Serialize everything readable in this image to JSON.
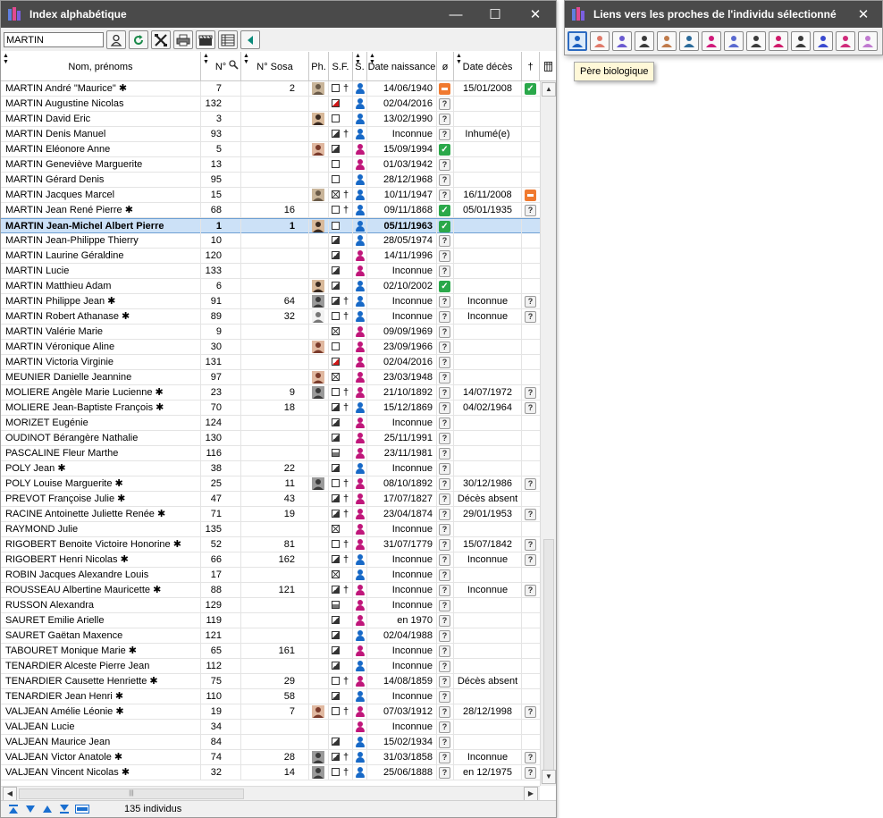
{
  "main_window": {
    "title": "Index alphabétique",
    "search_value": "MARTIN",
    "toolbar_icons": [
      "person-search-icon",
      "refresh-icon",
      "tools-icon",
      "print-icon",
      "clapperboard-icon",
      "table-icon",
      "collapse-left-icon"
    ],
    "columns": {
      "name": "Nom, prénoms",
      "num": "N°",
      "sosa": "N° Sosa",
      "photo": "Ph.",
      "sf": "S.F.",
      "sex": "S.",
      "birth": "Date naissance",
      "o": "ø",
      "death": "Date décès",
      "dagger": "†"
    },
    "status_text": "135  individus"
  },
  "links_window": {
    "title": "Liens vers les proches de l'individu sélectionné",
    "tooltip": "Père biologique",
    "icons": [
      "father-icon",
      "mother-icon",
      "parents-icon",
      "siblings-icon",
      "couple-icon",
      "children-icon",
      "ring-icon",
      "family-icon",
      "grandparents-icon",
      "half-siblings-icon",
      "cousins-icon",
      "descendants-icon",
      "ancestors-icon",
      "tree-chart-icon"
    ]
  },
  "colors": {
    "male": "#1769c7",
    "female": "#c0167a",
    "selected_row": "#cce1f7",
    "ok_badge": "#2aa84a",
    "warn_badge": "#f07a30",
    "titlebar": "#4a4a4a"
  },
  "rows": [
    {
      "name": "MARTIN André \"Maurice\"",
      "star": true,
      "num": "7",
      "sosa": "2",
      "photo": "man-old",
      "sf": "empty",
      "dagger": true,
      "sex": "m",
      "birth": "14/06/1940",
      "o": "minus",
      "death": "15/01/2008",
      "d": "ok"
    },
    {
      "name": "MARTIN Augustine Nicolas",
      "star": false,
      "num": "132",
      "sosa": "",
      "photo": "",
      "sf": "red",
      "dagger": false,
      "sex": "m",
      "birth": "02/04/2016",
      "o": "q",
      "death": "",
      "d": ""
    },
    {
      "name": "MARTIN David Eric",
      "star": false,
      "num": "3",
      "sosa": "",
      "photo": "man-young",
      "sf": "empty",
      "dagger": false,
      "sex": "m",
      "birth": "13/02/1990",
      "o": "q",
      "death": "",
      "d": ""
    },
    {
      "name": "MARTIN Denis Manuel",
      "star": false,
      "num": "93",
      "sosa": "",
      "photo": "",
      "sf": "half",
      "dagger": true,
      "sex": "m",
      "birth": "Inconnue",
      "o": "q",
      "death": "Inhumé(e)",
      "d": ""
    },
    {
      "name": "MARTIN Eléonore Anne",
      "star": false,
      "num": "5",
      "sosa": "",
      "photo": "woman",
      "sf": "half",
      "dagger": false,
      "sex": "f",
      "birth": "15/09/1994",
      "o": "ok",
      "death": "",
      "d": ""
    },
    {
      "name": "MARTIN Geneviève Marguerite",
      "star": false,
      "num": "13",
      "sosa": "",
      "photo": "",
      "sf": "empty",
      "dagger": false,
      "sex": "f",
      "birth": "01/03/1942",
      "o": "q",
      "death": "",
      "d": ""
    },
    {
      "name": "MARTIN Gérard Denis",
      "star": false,
      "num": "95",
      "sosa": "",
      "photo": "",
      "sf": "empty",
      "dagger": false,
      "sex": "m",
      "birth": "28/12/1968",
      "o": "q",
      "death": "",
      "d": ""
    },
    {
      "name": "MARTIN Jacques Marcel",
      "star": false,
      "num": "15",
      "sosa": "",
      "photo": "man-old",
      "sf": "x",
      "dagger": true,
      "sex": "m",
      "birth": "10/11/1947",
      "o": "q",
      "death": "16/11/2008",
      "d": "minus"
    },
    {
      "name": "MARTIN Jean René Pierre",
      "star": true,
      "num": "68",
      "sosa": "16",
      "photo": "",
      "sf": "empty",
      "dagger": true,
      "sex": "m",
      "birth": "09/11/1868",
      "o": "ok",
      "death": "05/01/1935",
      "d": "q"
    },
    {
      "name": "MARTIN Jean-Michel Albert Pierre",
      "star": false,
      "num": "1",
      "sosa": "1",
      "photo": "man-young",
      "sf": "empty",
      "dagger": false,
      "sex": "m",
      "birth": "05/11/1963",
      "o": "ok",
      "death": "",
      "d": "",
      "selected": true
    },
    {
      "name": "MARTIN Jean-Philippe Thierry",
      "star": false,
      "num": "10",
      "sosa": "",
      "photo": "",
      "sf": "half",
      "dagger": false,
      "sex": "m",
      "birth": "28/05/1974",
      "o": "q",
      "death": "",
      "d": ""
    },
    {
      "name": "MARTIN Laurine Géraldine",
      "star": false,
      "num": "120",
      "sosa": "",
      "photo": "",
      "sf": "half",
      "dagger": false,
      "sex": "f",
      "birth": "14/11/1996",
      "o": "q",
      "death": "",
      "d": ""
    },
    {
      "name": "MARTIN Lucie",
      "star": false,
      "num": "133",
      "sosa": "",
      "photo": "",
      "sf": "half",
      "dagger": false,
      "sex": "f",
      "birth": "Inconnue",
      "o": "q",
      "death": "",
      "d": ""
    },
    {
      "name": "MARTIN Matthieu Adam",
      "star": false,
      "num": "6",
      "sosa": "",
      "photo": "man-young",
      "sf": "half",
      "dagger": false,
      "sex": "m",
      "birth": "02/10/2002",
      "o": "ok",
      "death": "",
      "d": ""
    },
    {
      "name": "MARTIN Philippe Jean",
      "star": true,
      "num": "91",
      "sosa": "64",
      "photo": "old-photo",
      "sf": "half",
      "dagger": true,
      "sex": "m",
      "birth": "Inconnue",
      "o": "q",
      "death": "Inconnue",
      "d": "q"
    },
    {
      "name": "MARTIN Robert Athanase",
      "star": true,
      "num": "89",
      "sosa": "32",
      "photo": "sketch",
      "sf": "empty",
      "dagger": true,
      "sex": "m",
      "birth": "Inconnue",
      "o": "q",
      "death": "Inconnue",
      "d": "q"
    },
    {
      "name": "MARTIN Valérie Marie",
      "star": false,
      "num": "9",
      "sosa": "",
      "photo": "",
      "sf": "x",
      "dagger": false,
      "sex": "f",
      "birth": "09/09/1969",
      "o": "q",
      "death": "",
      "d": ""
    },
    {
      "name": "MARTIN Véronique Aline",
      "star": false,
      "num": "30",
      "sosa": "",
      "photo": "woman",
      "sf": "empty",
      "dagger": false,
      "sex": "f",
      "birth": "23/09/1966",
      "o": "q",
      "death": "",
      "d": ""
    },
    {
      "name": "MARTIN Victoria Virginie",
      "star": false,
      "num": "131",
      "sosa": "",
      "photo": "",
      "sf": "red",
      "dagger": false,
      "sex": "f",
      "birth": "02/04/2016",
      "o": "q",
      "death": "",
      "d": ""
    },
    {
      "name": "MEUNIER Danielle Jeannine",
      "star": false,
      "num": "97",
      "sosa": "",
      "photo": "woman",
      "sf": "x",
      "dagger": false,
      "sex": "f",
      "birth": "23/03/1948",
      "o": "q",
      "death": "",
      "d": ""
    },
    {
      "name": "MOLIERE Angèle Marie Lucienne",
      "star": true,
      "num": "23",
      "sosa": "9",
      "photo": "old-photo",
      "sf": "empty",
      "dagger": true,
      "sex": "f",
      "birth": "21/10/1892",
      "o": "q",
      "death": "14/07/1972",
      "d": "q"
    },
    {
      "name": "MOLIERE Jean-Baptiste François",
      "star": true,
      "num": "70",
      "sosa": "18",
      "photo": "",
      "sf": "half",
      "dagger": true,
      "sex": "m",
      "birth": "15/12/1869",
      "o": "q",
      "death": "04/02/1964",
      "d": "q"
    },
    {
      "name": "MORIZET Eugénie",
      "star": false,
      "num": "124",
      "sosa": "",
      "photo": "",
      "sf": "half",
      "dagger": false,
      "sex": "f",
      "birth": "Inconnue",
      "o": "q",
      "death": "",
      "d": ""
    },
    {
      "name": "OUDINOT Bérangère Nathalie",
      "star": false,
      "num": "130",
      "sosa": "",
      "photo": "",
      "sf": "half",
      "dagger": false,
      "sex": "f",
      "birth": "25/11/1991",
      "o": "q",
      "death": "",
      "d": ""
    },
    {
      "name": "PASCALINE Fleur Marthe",
      "star": false,
      "num": "116",
      "sosa": "",
      "photo": "",
      "sf": "ax",
      "dagger": false,
      "sex": "f",
      "birth": "23/11/1981",
      "o": "q",
      "death": "",
      "d": ""
    },
    {
      "name": "POLY Jean",
      "star": true,
      "num": "38",
      "sosa": "22",
      "photo": "",
      "sf": "half",
      "dagger": false,
      "sex": "m",
      "birth": "Inconnue",
      "o": "q",
      "death": "",
      "d": ""
    },
    {
      "name": "POLY Louise Marguerite",
      "star": true,
      "num": "25",
      "sosa": "11",
      "photo": "old-photo",
      "sf": "empty",
      "dagger": true,
      "sex": "f",
      "birth": "08/10/1892",
      "o": "q",
      "death": "30/12/1986",
      "d": "q"
    },
    {
      "name": "PREVOT Françoise Julie",
      "star": true,
      "num": "47",
      "sosa": "43",
      "photo": "",
      "sf": "half",
      "dagger": true,
      "sex": "f",
      "birth": "17/07/1827",
      "o": "q",
      "death": "Décès absent",
      "d": ""
    },
    {
      "name": "RACINE Antoinette Juliette Renée",
      "star": true,
      "num": "71",
      "sosa": "19",
      "photo": "",
      "sf": "half",
      "dagger": true,
      "sex": "f",
      "birth": "23/04/1874",
      "o": "q",
      "death": "29/01/1953",
      "d": "q"
    },
    {
      "name": "RAYMOND Julie",
      "star": false,
      "num": "135",
      "sosa": "",
      "photo": "",
      "sf": "x",
      "dagger": false,
      "sex": "f",
      "birth": "Inconnue",
      "o": "q",
      "death": "",
      "d": ""
    },
    {
      "name": "RIGOBERT Benoite Victoire Honorine",
      "star": true,
      "num": "52",
      "sosa": "81",
      "photo": "",
      "sf": "empty",
      "dagger": true,
      "sex": "f",
      "birth": "31/07/1779",
      "o": "q",
      "death": "15/07/1842",
      "d": "q"
    },
    {
      "name": "RIGOBERT Henri Nicolas",
      "star": true,
      "num": "66",
      "sosa": "162",
      "photo": "",
      "sf": "half",
      "dagger": true,
      "sex": "m",
      "birth": "Inconnue",
      "o": "q",
      "death": "Inconnue",
      "d": "q"
    },
    {
      "name": "ROBIN Jacques Alexandre Louis",
      "star": false,
      "num": "17",
      "sosa": "",
      "photo": "",
      "sf": "x",
      "dagger": false,
      "sex": "m",
      "birth": "Inconnue",
      "o": "q",
      "death": "",
      "d": ""
    },
    {
      "name": "ROUSSEAU Albertine Mauricette",
      "star": true,
      "num": "88",
      "sosa": "121",
      "photo": "",
      "sf": "half",
      "dagger": true,
      "sex": "f",
      "birth": "Inconnue",
      "o": "q",
      "death": "Inconnue",
      "d": "q"
    },
    {
      "name": "RUSSON Alexandra",
      "star": false,
      "num": "129",
      "sosa": "",
      "photo": "",
      "sf": "ax",
      "dagger": false,
      "sex": "f",
      "birth": "Inconnue",
      "o": "q",
      "death": "",
      "d": ""
    },
    {
      "name": "SAURET Emilie Arielle",
      "star": false,
      "num": "119",
      "sosa": "",
      "photo": "",
      "sf": "half",
      "dagger": false,
      "sex": "f",
      "birth": "en 1970",
      "o": "q",
      "death": "",
      "d": ""
    },
    {
      "name": "SAURET Gaëtan Maxence",
      "star": false,
      "num": "121",
      "sosa": "",
      "photo": "",
      "sf": "half",
      "dagger": false,
      "sex": "m",
      "birth": "02/04/1988",
      "o": "q",
      "death": "",
      "d": ""
    },
    {
      "name": "TABOURET Monique Marie",
      "star": true,
      "num": "65",
      "sosa": "161",
      "photo": "",
      "sf": "half",
      "dagger": false,
      "sex": "f",
      "birth": "Inconnue",
      "o": "q",
      "death": "",
      "d": ""
    },
    {
      "name": "TENARDIER Alceste Pierre Jean",
      "star": false,
      "num": "112",
      "sosa": "",
      "photo": "",
      "sf": "half",
      "dagger": false,
      "sex": "m",
      "birth": "Inconnue",
      "o": "q",
      "death": "",
      "d": ""
    },
    {
      "name": "TENARDIER Causette Henriette",
      "star": true,
      "num": "75",
      "sosa": "29",
      "photo": "",
      "sf": "empty",
      "dagger": true,
      "sex": "f",
      "birth": "14/08/1859",
      "o": "q",
      "death": "Décès absent",
      "d": ""
    },
    {
      "name": "TENARDIER Jean Henri",
      "star": true,
      "num": "110",
      "sosa": "58",
      "photo": "",
      "sf": "half",
      "dagger": false,
      "sex": "m",
      "birth": "Inconnue",
      "o": "q",
      "death": "",
      "d": ""
    },
    {
      "name": "VALJEAN Amélie Léonie",
      "star": true,
      "num": "19",
      "sosa": "7",
      "photo": "woman",
      "sf": "empty",
      "dagger": true,
      "sex": "f",
      "birth": "07/03/1912",
      "o": "q",
      "death": "28/12/1998",
      "d": "q"
    },
    {
      "name": "VALJEAN Lucie",
      "star": false,
      "num": "34",
      "sosa": "",
      "photo": "",
      "sf": "",
      "dagger": false,
      "sex": "f",
      "birth": "Inconnue",
      "o": "q",
      "death": "",
      "d": ""
    },
    {
      "name": "VALJEAN Maurice Jean",
      "star": false,
      "num": "84",
      "sosa": "",
      "photo": "",
      "sf": "half",
      "dagger": false,
      "sex": "m",
      "birth": "15/02/1934",
      "o": "q",
      "death": "",
      "d": ""
    },
    {
      "name": "VALJEAN Victor Anatole",
      "star": true,
      "num": "74",
      "sosa": "28",
      "photo": "old-photo",
      "sf": "half",
      "dagger": true,
      "sex": "m",
      "birth": "31/03/1858",
      "o": "q",
      "death": "Inconnue",
      "d": "q"
    },
    {
      "name": "VALJEAN Vincent Nicolas",
      "star": true,
      "num": "32",
      "sosa": "14",
      "photo": "old-photo",
      "sf": "empty",
      "dagger": true,
      "sex": "m",
      "birth": "25/06/1888",
      "o": "q",
      "death": "en 12/1975",
      "d": "q"
    }
  ]
}
